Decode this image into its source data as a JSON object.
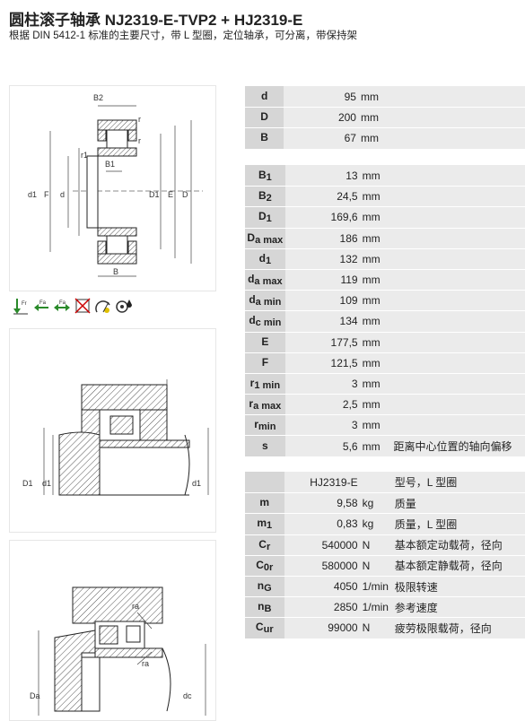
{
  "title": "圆柱滚子轴承 NJ2319-E-TVP2 + HJ2319-E",
  "subtitle": "根据 DIN 5412-1 标准的主要尺寸，带 L 型圈，定位轴承，可分离，带保持架",
  "drawing_labels": {
    "B2": "B2",
    "r_top": "r",
    "r_mid": "r",
    "r1": "r1",
    "B1": "B1",
    "d1": "d1",
    "F": "F",
    "d": "d",
    "D1": "D1",
    "E": "E",
    "D": "D",
    "B": "B"
  },
  "mount_labels": {
    "D1": "D1",
    "d1_left": "d1",
    "d1_right": "d1",
    "ra_top": "ra",
    "ra_bottom": "ra",
    "Da": "Da",
    "dc": "dc"
  },
  "icons": [
    "radial-load-icon",
    "axial-load-left-icon",
    "axial-load-both-icon",
    "not-sealed-icon",
    "speed-rating-icon",
    "lubrication-icon"
  ],
  "group1": [
    {
      "sym": "d",
      "sub": "",
      "value": "95",
      "unit": "mm",
      "desc": ""
    },
    {
      "sym": "D",
      "sub": "",
      "value": "200",
      "unit": "mm",
      "desc": ""
    },
    {
      "sym": "B",
      "sub": "",
      "value": "67",
      "unit": "mm",
      "desc": ""
    }
  ],
  "group2": [
    {
      "sym": "B",
      "sub": "1",
      "value": "13",
      "unit": "mm",
      "desc": ""
    },
    {
      "sym": "B",
      "sub": "2",
      "value": "24,5",
      "unit": "mm",
      "desc": ""
    },
    {
      "sym": "D",
      "sub": "1",
      "value": "169,6",
      "unit": "mm",
      "desc": ""
    },
    {
      "sym": "D",
      "sub": "a max",
      "value": "186",
      "unit": "mm",
      "desc": ""
    },
    {
      "sym": "d",
      "sub": "1",
      "value": "132",
      "unit": "mm",
      "desc": ""
    },
    {
      "sym": "d",
      "sub": "a max",
      "value": "119",
      "unit": "mm",
      "desc": ""
    },
    {
      "sym": "d",
      "sub": "a min",
      "value": "109",
      "unit": "mm",
      "desc": ""
    },
    {
      "sym": "d",
      "sub": "c min",
      "value": "134",
      "unit": "mm",
      "desc": ""
    },
    {
      "sym": "E",
      "sub": "",
      "value": "177,5",
      "unit": "mm",
      "desc": ""
    },
    {
      "sym": "F",
      "sub": "",
      "value": "121,5",
      "unit": "mm",
      "desc": ""
    },
    {
      "sym": "r",
      "sub": "1 min",
      "value": "3",
      "unit": "mm",
      "desc": ""
    },
    {
      "sym": "r",
      "sub": "a max",
      "value": "2,5",
      "unit": "mm",
      "desc": ""
    },
    {
      "sym": "r",
      "sub": "min",
      "value": "3",
      "unit": "mm",
      "desc": ""
    },
    {
      "sym": "s",
      "sub": "",
      "value": "5,6",
      "unit": "mm",
      "desc": "距离中心位置的轴向偏移"
    }
  ],
  "group3": [
    {
      "sym": "",
      "sub": "",
      "value": "HJ2319-E",
      "unit": "",
      "desc": "型号，L 型圈"
    },
    {
      "sym": "m",
      "sub": "",
      "value": "9,58",
      "unit": "kg",
      "desc": "质量"
    },
    {
      "sym": "m",
      "sub": "1",
      "value": "0,83",
      "unit": "kg",
      "desc": "质量，L 型圈"
    },
    {
      "sym": "C",
      "sub": "r",
      "value": "540000",
      "unit": "N",
      "desc": "基本额定动载荷，径向"
    },
    {
      "sym": "C",
      "sub": "0r",
      "value": "580000",
      "unit": "N",
      "desc": "基本额定静载荷，径向"
    },
    {
      "sym": "n",
      "sub": "G",
      "value": "4050",
      "unit": "1/min",
      "desc": "极限转速"
    },
    {
      "sym": "n",
      "sub": "B",
      "value": "2850",
      "unit": "1/min",
      "desc": "参考速度"
    },
    {
      "sym": "C",
      "sub": "ur",
      "value": "99000",
      "unit": "N",
      "desc": "疲劳极限载荷，径向"
    }
  ]
}
